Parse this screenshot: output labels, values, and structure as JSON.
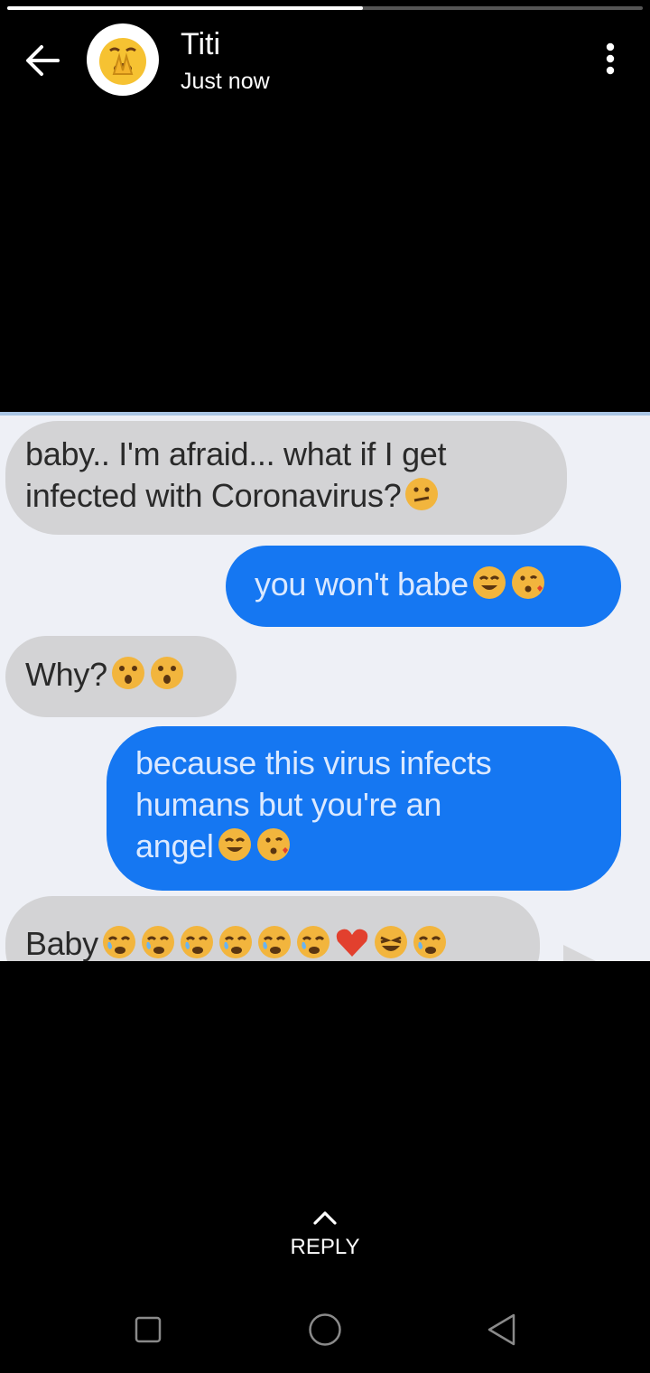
{
  "status": {
    "progress": 0.56,
    "poster_name": "Titi",
    "posted_time": "Just now",
    "avatar_icon": "shushing-face-emoji-icon"
  },
  "messages": [
    {
      "side": "incoming",
      "lines": [
        "baby.. I'm afraid... what if I get",
        "infected with Coronavirus?"
      ],
      "emojis": [
        "confused-face"
      ]
    },
    {
      "side": "outgoing",
      "lines": [
        "you won't babe"
      ],
      "emojis": [
        "smiling-face",
        "kissing-face"
      ]
    },
    {
      "side": "incoming",
      "lines": [
        "Why?"
      ],
      "emojis": [
        "astonished-face",
        "astonished-face"
      ]
    },
    {
      "side": "outgoing",
      "lines": [
        "because this virus infects",
        "humans  but you're an",
        "angel"
      ],
      "emojis": [
        "smiling-face",
        "kissing-face"
      ]
    },
    {
      "side": "incoming",
      "lines": [
        "Baby"
      ],
      "emojis": [
        "crying-face",
        "crying-face",
        "crying-face",
        "crying-face",
        "crying-face",
        "crying-face",
        "red-heart",
        "laughing-face",
        "crying-face"
      ]
    }
  ],
  "reply": {
    "label": "REPLY",
    "icon": "chevron-up-icon"
  },
  "navbar": {
    "items": [
      "recent-apps-icon",
      "home-icon",
      "back-icon"
    ]
  },
  "colors": {
    "outgoing_bubble": "#1577f2",
    "incoming_bubble": "#d3d3d5",
    "background": "#000000"
  }
}
